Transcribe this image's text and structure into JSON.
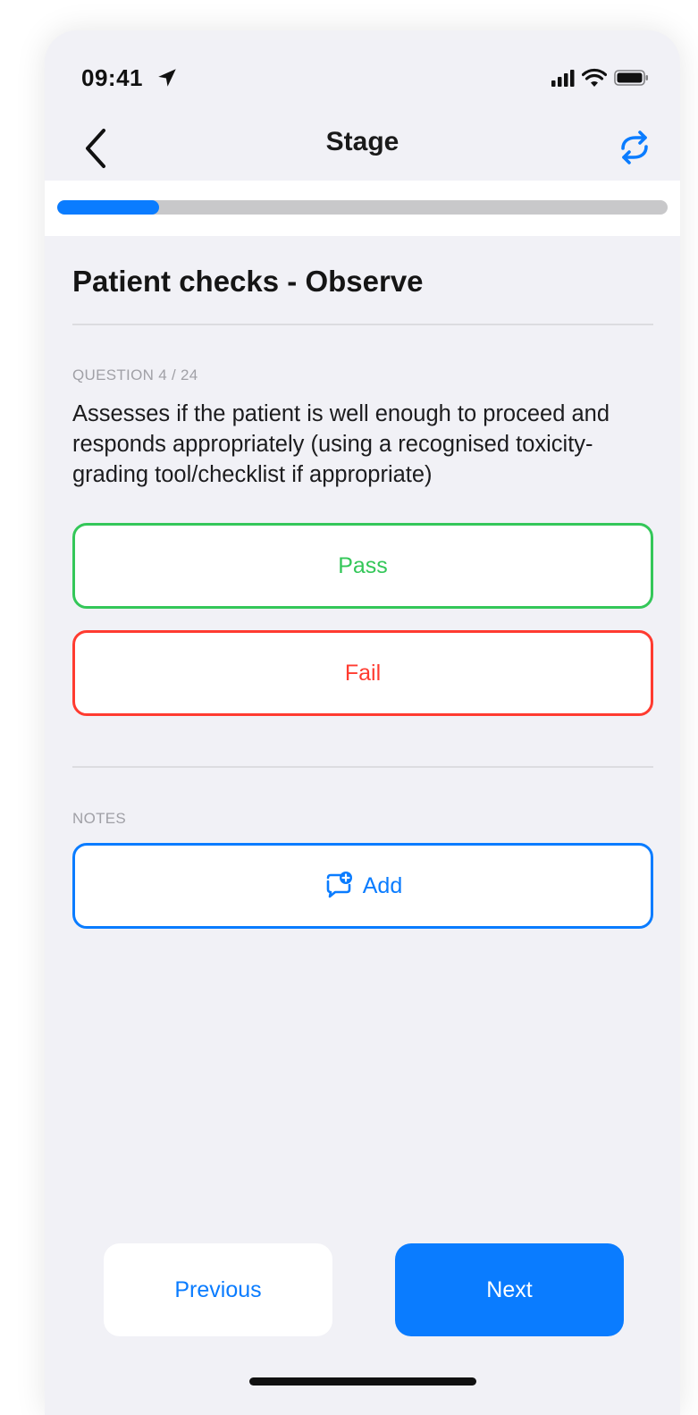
{
  "status_bar": {
    "time": "09:41"
  },
  "nav": {
    "title": "Stage"
  },
  "progress": {
    "fraction": 0.167
  },
  "section": {
    "title": "Patient checks - Observe"
  },
  "question": {
    "counter": "QUESTION 4 / 24",
    "text": "Assesses if the patient is well enough to proceed and responds appropriately (using a recognised toxicity-grading tool/checklist if appropriate)"
  },
  "answers": {
    "pass_label": "Pass",
    "fail_label": "Fail"
  },
  "notes": {
    "label": "NOTES",
    "add_label": "Add"
  },
  "footer": {
    "previous_label": "Previous",
    "next_label": "Next"
  },
  "colors": {
    "accent": "#0a7cff",
    "pass": "#34c759",
    "fail": "#ff3b30"
  },
  "icons": [
    "location-arrow-icon",
    "cellular-signal-icon",
    "wifi-icon",
    "battery-icon",
    "back-chevron-icon",
    "sync-icon",
    "add-comment-icon"
  ]
}
